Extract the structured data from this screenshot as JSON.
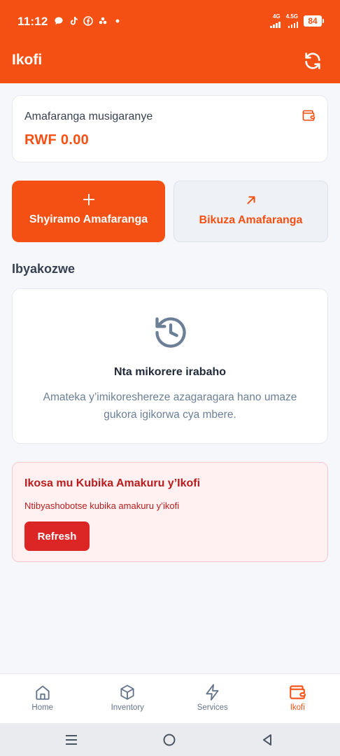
{
  "status_bar": {
    "time": "11:12",
    "left_icons": [
      "chat-bubble-icon",
      "tiktok-icon",
      "facebook-icon",
      "app-icon"
    ],
    "network_labels": [
      "4G",
      "4.5G"
    ],
    "battery": "84"
  },
  "header": {
    "title": "Ikofi",
    "refresh_icon": "refresh-icon"
  },
  "balance": {
    "label": "Amafaranga musigaranye",
    "amount": "RWF 0.00",
    "icon": "wallet-icon"
  },
  "actions": {
    "deposit": {
      "label": "Shyiramo Amafaranga",
      "icon": "plus-icon"
    },
    "withdraw": {
      "label": "Bikuza Amafaranga",
      "icon": "arrow-up-right-icon"
    }
  },
  "transactions": {
    "title": "Ibyakozwe",
    "empty_title": "Nta mikorere irabaho",
    "empty_text": "Amateka y’imikoreshereze azagaragara hano umaze gukora igikorwa cya mbere."
  },
  "error": {
    "title": "Ikosa mu Kubika Amakuru y’Ikofi",
    "message": "Ntibyashobotse kubika amakuru y’ikofi",
    "button": "Refresh"
  },
  "bottom_nav": {
    "items": [
      {
        "label": "Home",
        "icon": "home-icon",
        "active": false
      },
      {
        "label": "Inventory",
        "icon": "box-icon",
        "active": false
      },
      {
        "label": "Services",
        "icon": "lightning-icon",
        "active": false
      },
      {
        "label": "Ikofi",
        "icon": "wallet-icon",
        "active": true
      }
    ]
  },
  "colors": {
    "brand": "#f55014",
    "error": "#dc2626",
    "background": "#f5f7fb"
  }
}
